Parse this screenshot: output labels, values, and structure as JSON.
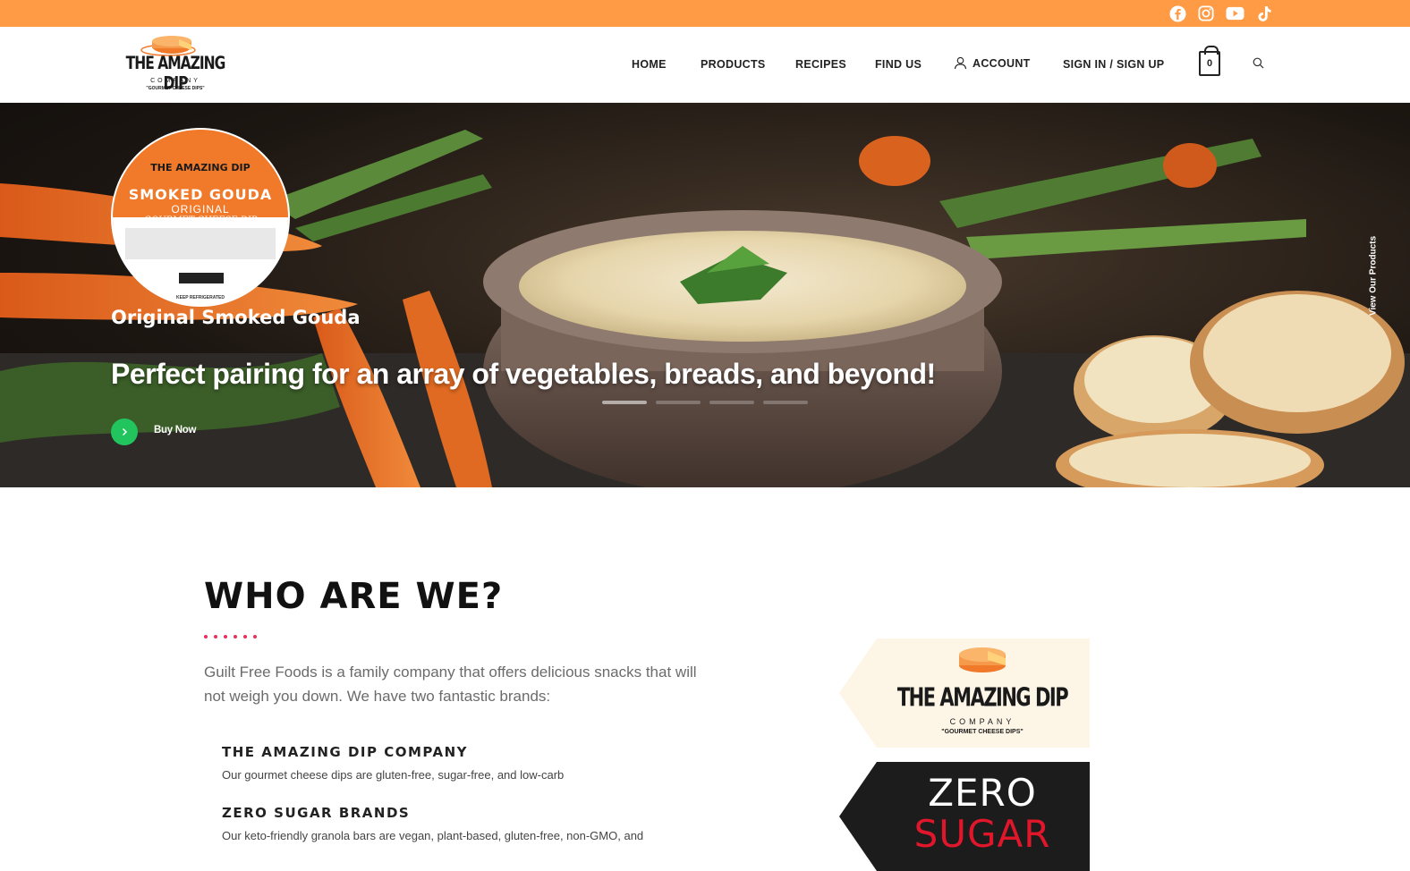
{
  "colors": {
    "topbar": "#ff9a45",
    "accent_green": "#22c45e",
    "dot_red": "#e8305a",
    "brand_orange": "#f07a2a"
  },
  "social": [
    {
      "icon": "facebook-icon"
    },
    {
      "icon": "instagram-icon"
    },
    {
      "icon": "youtube-icon"
    },
    {
      "icon": "tiktok-icon"
    }
  ],
  "logo": {
    "line1": "THE AMAZING DIP",
    "line2": "COMPANY",
    "tagline": "\"GOURMET CHEESE DIPS\""
  },
  "nav": {
    "home": "HOME",
    "products": "PRODUCTS",
    "recipes": "RECIPES",
    "find_us": "FIND US",
    "account": "ACCOUNT",
    "signin": "SIGN IN / SIGN UP",
    "cart_count": "0"
  },
  "hero": {
    "label_brand": "THE AMAZING DIP",
    "label_flavor": "SMOKED GOUDA",
    "label_sub": "ORIGINAL",
    "label_cheese": "GOURMET CHEESE DIP",
    "label_keep": "KEEP REFRIGERATED",
    "product_name": "Original Smoked Gouda",
    "headline": "Perfect pairing for an array of vegetables, breads, and beyond!",
    "buy_label": "Buy Now",
    "side_label": "View Our Products",
    "slide_count": 4
  },
  "about": {
    "title": "WHO ARE WE?",
    "intro": "Guilt Free Foods is a family company that offers delicious snacks that will not weigh you down. We have two fantastic brands:",
    "brands": [
      {
        "name": "THE AMAZING DIP COMPANY",
        "desc": "Our gourmet cheese dips are gluten-free, sugar-free, and low-carb"
      },
      {
        "name": "ZERO SUGAR BRANDS",
        "desc": "Our keto-friendly granola bars are vegan, plant-based, gluten-free, non-GMO, and"
      }
    ],
    "badge_zero_line1": "ZERO",
    "badge_zero_line2": "SUGAR"
  }
}
